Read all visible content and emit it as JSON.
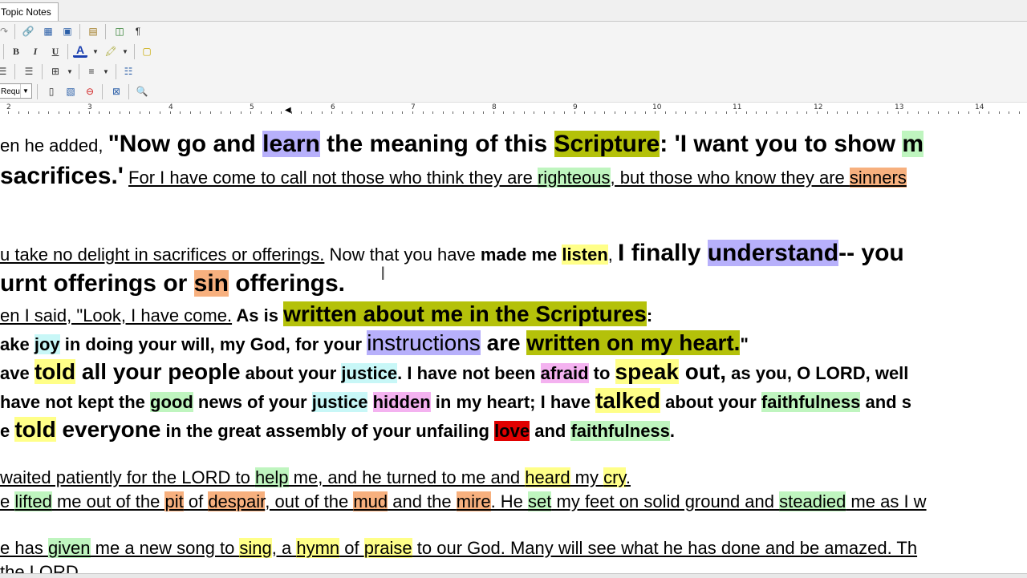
{
  "tab": {
    "label": "Topic Notes"
  },
  "toolbar": {
    "style_value": "Requ",
    "buttons_row1": [
      "undo-icon",
      "link-icon",
      "table-icon",
      "image-icon",
      "page-icon",
      "window-icon",
      "pilcrow-icon"
    ],
    "buttons_row2": [
      "bold",
      "italic",
      "underline",
      "font-color",
      "highlight-color",
      "note-icon"
    ],
    "bold_label": "B",
    "italic_label": "I",
    "underline_label": "U",
    "fontcolor_label": "A",
    "pilcrow_label": "¶"
  },
  "ruler": {
    "numbers": [
      "2",
      "3",
      "4",
      "5",
      "6",
      "7",
      "8",
      "9",
      "10",
      "11",
      "12",
      "13",
      "14"
    ]
  },
  "document": {
    "l1": {
      "t1": "en he added, ",
      "t2": "\"Now go and ",
      "t3": "learn",
      "t4": " the meaning of this ",
      "t5": "Scripture",
      "t6": ": 'I want you to show ",
      "t7": "m"
    },
    "l2": {
      "t1": "sacrifices.'",
      "t2": " ",
      "t3": "For I have come to call not those who think they are ",
      "t4": "righteous",
      "t5": ", but those who know they are ",
      "t6": "sinners"
    },
    "l3": {
      "t1": "u take no delight in sacrifices or offerings.",
      "t2": " Now that you have ",
      "t3": "made me ",
      "t4": "listen",
      "t5": ", ",
      "t6": "I finally ",
      "t7": "understand",
      "t8": "-- you"
    },
    "l4": {
      "t1": "urnt offerings or ",
      "t2": "sin",
      "t3": " offerings."
    },
    "l5": {
      "t1": "en I said, \"Look, I have come.",
      "t2": " As is ",
      "t3": "written about me in the Scriptures",
      "t4": ":"
    },
    "l6": {
      "t1": "ake ",
      "t2": "joy",
      "t3": " in doing your will, my God, for your ",
      "t4": "instructions",
      "t5": " are ",
      "t6": "written on my heart.",
      "t7": "\""
    },
    "l7": {
      "t1": "ave ",
      "t2": "told",
      "t3": " all your people",
      "t4": " about your ",
      "t5": "justice",
      "t6": ". I have not been ",
      "t7": "afraid",
      "t8": " to ",
      "t9": "speak",
      "t10": " out,",
      "t11": " as you, O LORD, well"
    },
    "l8": {
      "t1": "have not kept the ",
      "t2": "good",
      "t3": " news of your ",
      "t4": "justice",
      "t5": " ",
      "t6": "hidden",
      "t7": " in my heart; I have ",
      "t8": "talked",
      "t9": " about your ",
      "t10": "faithfulness",
      "t11": " and s"
    },
    "l9": {
      "t1": "e ",
      "t2": "told",
      "t3": " everyone",
      "t4": " in the great assembly of your unfailing ",
      "t5": "love",
      "t6": " and ",
      "t7": "faithfulness",
      "t8": "."
    },
    "l10": {
      "t1": "waited patiently for the LORD to ",
      "t2": "help",
      "t3": " me, and he turned to me and ",
      "t4": "heard",
      "t5": " my ",
      "t6": "cry",
      "t7": "."
    },
    "l11": {
      "t1": "e ",
      "t2": "lifted",
      "t3": " me out of the ",
      "t4": "pit",
      "t5": " of ",
      "t6": "despair",
      "t7": ", out of the ",
      "t8": "mud",
      "t9": " and the ",
      "t10": "mire",
      "t11": ". He ",
      "t12": "set",
      "t13": " my feet on solid ground and ",
      "t14": "steadied",
      "t15": " me as I w"
    },
    "l12": {
      "t1": "e has ",
      "t2": "given",
      "t3": " me a new song to ",
      "t4": "sing",
      "t5": ", a ",
      "t6": "hymn",
      "t7": " of ",
      "t8": "praise",
      "t9": " to our God. Many will see what he has done and be amazed. Th"
    },
    "l13": {
      "t1": "the LORD."
    }
  },
  "colors": {
    "yellow": "#ffff88",
    "green": "#bff5bf",
    "orange": "#f7b07e",
    "purple": "#b7b0fb",
    "cyan": "#c8f7f7",
    "pink": "#f4b2f0",
    "olive": "#b4c10a",
    "red": "#e10000"
  }
}
